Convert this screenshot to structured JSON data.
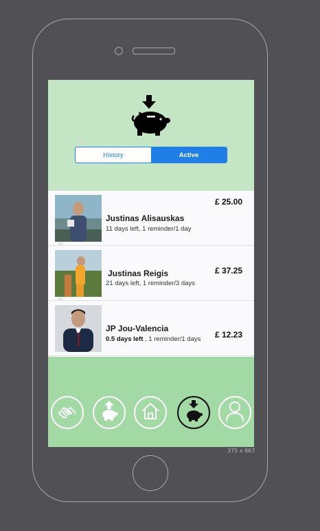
{
  "device": {
    "size_label": "375 x 667"
  },
  "header": {
    "logo_icon": "piggy-bank-deposit-icon",
    "tabs": [
      {
        "label": "History",
        "selected": false
      },
      {
        "label": "Active",
        "selected": true
      }
    ]
  },
  "pledges": [
    {
      "name": "Justinas Alisauskas",
      "days_left": "11 days left",
      "reminder": ", 1 reminder/1 day",
      "amount": "£ 25.00"
    },
    {
      "name": "Justinas Reigis",
      "days_left": "21 days left",
      "reminder": ", 1 reminder/3 days",
      "amount": "£ 37.25"
    },
    {
      "name": "JP Jou-Valencia",
      "days_left": "0.5 days left",
      "reminder": " , 1 reminder/1 days",
      "amount": "£ 12.23"
    }
  ],
  "nav": {
    "items": [
      {
        "icon": "handshake-icon",
        "selected": false
      },
      {
        "icon": "piggy-bank-withdraw-icon",
        "selected": false
      },
      {
        "icon": "home-icon",
        "selected": false
      },
      {
        "icon": "piggy-bank-deposit-icon",
        "selected": true
      },
      {
        "icon": "profile-icon",
        "selected": false
      }
    ]
  },
  "colors": {
    "header_bg": "#c4e6c4",
    "nav_bg": "#a3d9a5",
    "accent": "#1f7fe6"
  }
}
